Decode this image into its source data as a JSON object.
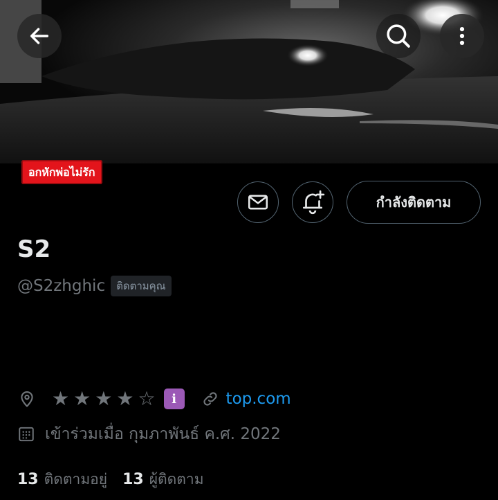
{
  "header": {
    "back_icon": "arrow-left-icon",
    "search_icon": "search-icon",
    "more_icon": "more-vertical-icon"
  },
  "banner_label": "อกหักพ่อไม่รัก",
  "actions": {
    "message_icon": "mail-icon",
    "notify_icon": "bell-plus-icon",
    "following_label": "กำลังติดตาม"
  },
  "profile": {
    "display_name": "S2",
    "handle": "@S2zhghic",
    "follows_you": "ติดตามคุณ",
    "rating_stars": [
      "★",
      "★",
      "★",
      "★",
      "☆"
    ],
    "emoji_badge": "ℹ",
    "website": "top.com",
    "joined": "เข้าร่วมเมื่อ กุมภาพันธ์ ค.ศ. 2022",
    "following_count": "13",
    "following_label": "ติดตามอยู่",
    "followers_count": "13",
    "followers_label": "ผู้ติดตาม"
  },
  "colors": {
    "accent": "#1d9bf0",
    "ribbon": "#e3141b",
    "muted": "#71767b",
    "emoji_badge": "#9b59b6"
  }
}
